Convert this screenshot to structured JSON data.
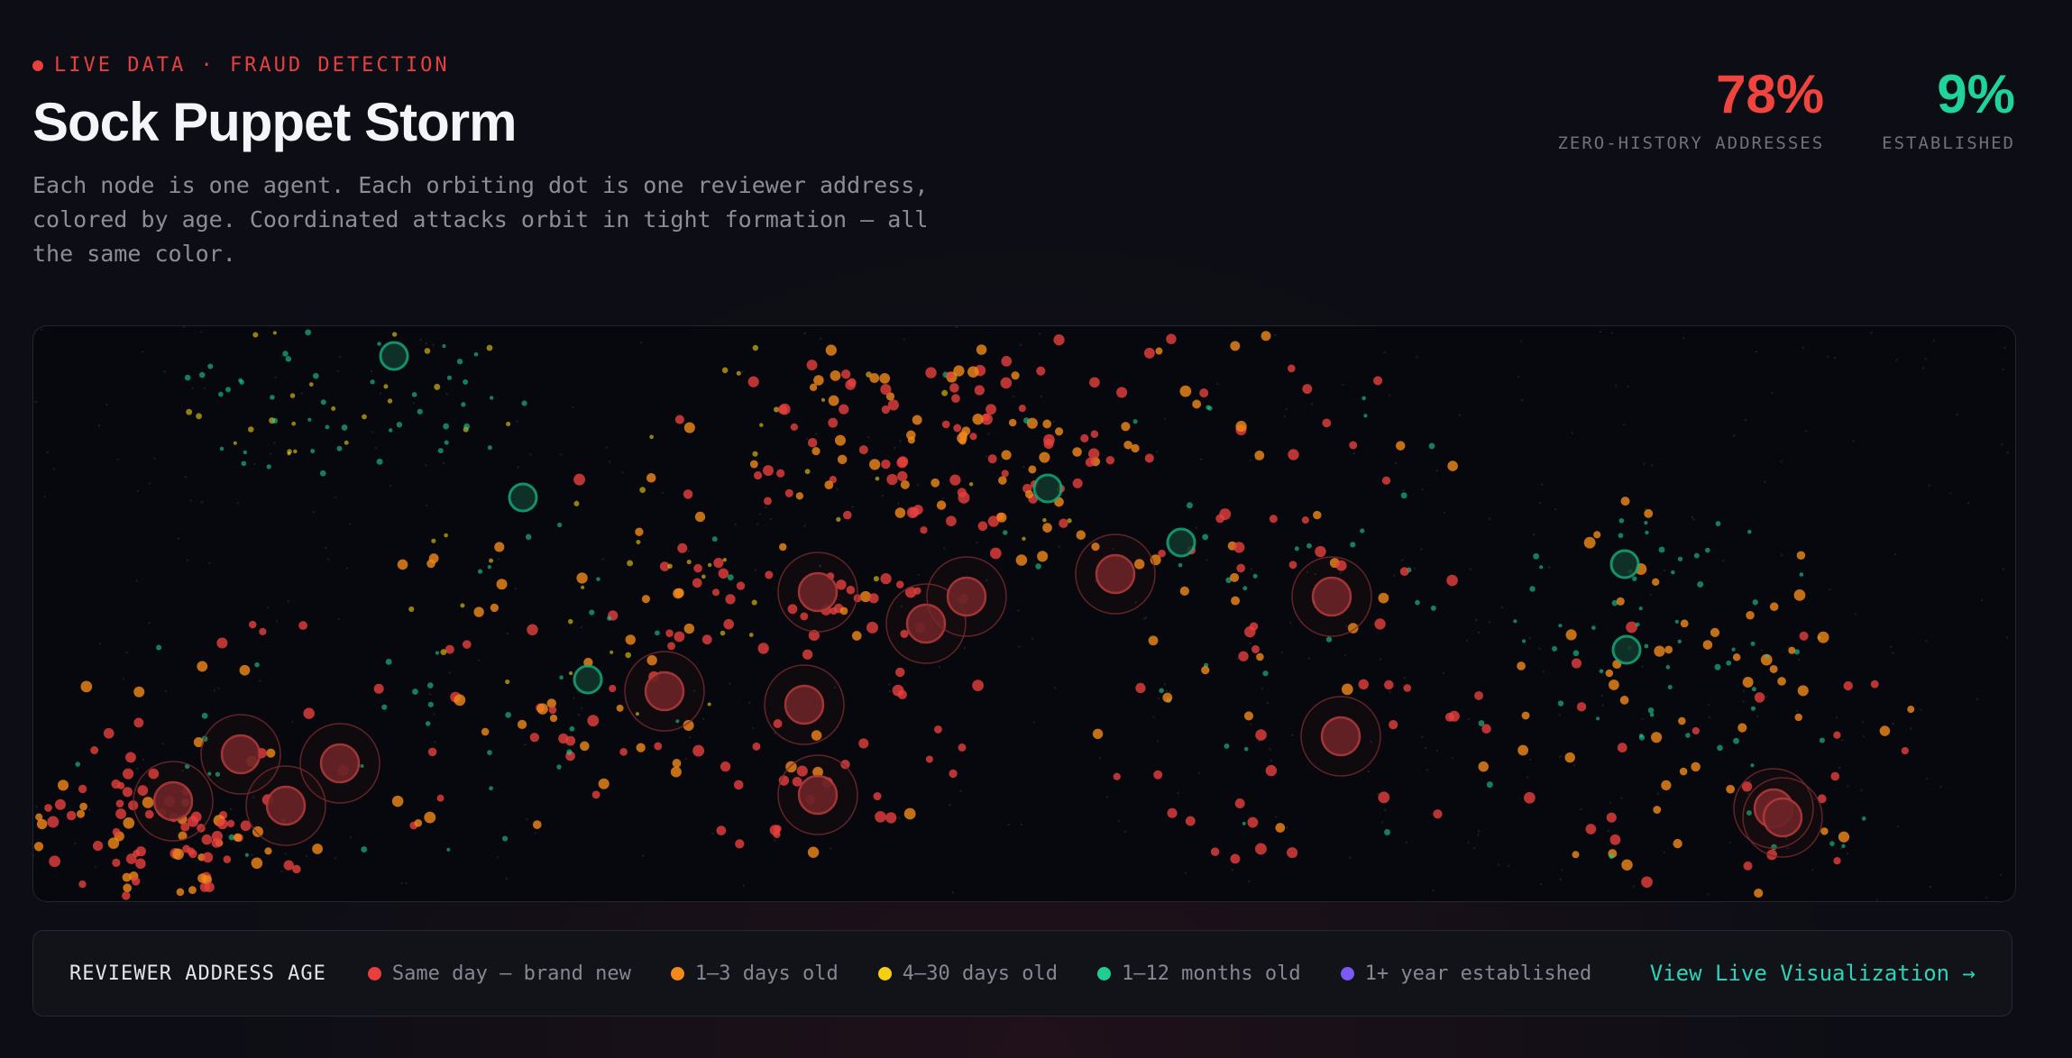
{
  "header": {
    "live_label": "LIVE DATA · FRAUD DETECTION",
    "title": "Sock Puppet Storm",
    "description": "Each node is one agent. Each orbiting dot is one reviewer address, colored by age. Coordinated attacks orbit in tight formation — all the same color."
  },
  "stats": [
    {
      "value": "78%",
      "label": "ZERO-HISTORY ADDRESSES",
      "color": "#f0453f"
    },
    {
      "value": "9%",
      "label": "ESTABLISHED",
      "color": "#1fd39a"
    }
  ],
  "legend": {
    "title": "REVIEWER ADDRESS AGE",
    "items": [
      {
        "label": "Same day — brand new",
        "color": "#e8403f"
      },
      {
        "label": "1–3 days old",
        "color": "#f28a1b"
      },
      {
        "label": "4–30 days old",
        "color": "#f5cf14"
      },
      {
        "label": "1–12 months old",
        "color": "#1fcf8f"
      },
      {
        "label": "1+ year established",
        "color": "#7a5af5"
      }
    ],
    "link_label": "View Live Visualization →"
  },
  "colors": {
    "live": "#e8403f",
    "accent": "#2ed3b7",
    "background": "#0d0e15",
    "panel": "#07080d"
  }
}
